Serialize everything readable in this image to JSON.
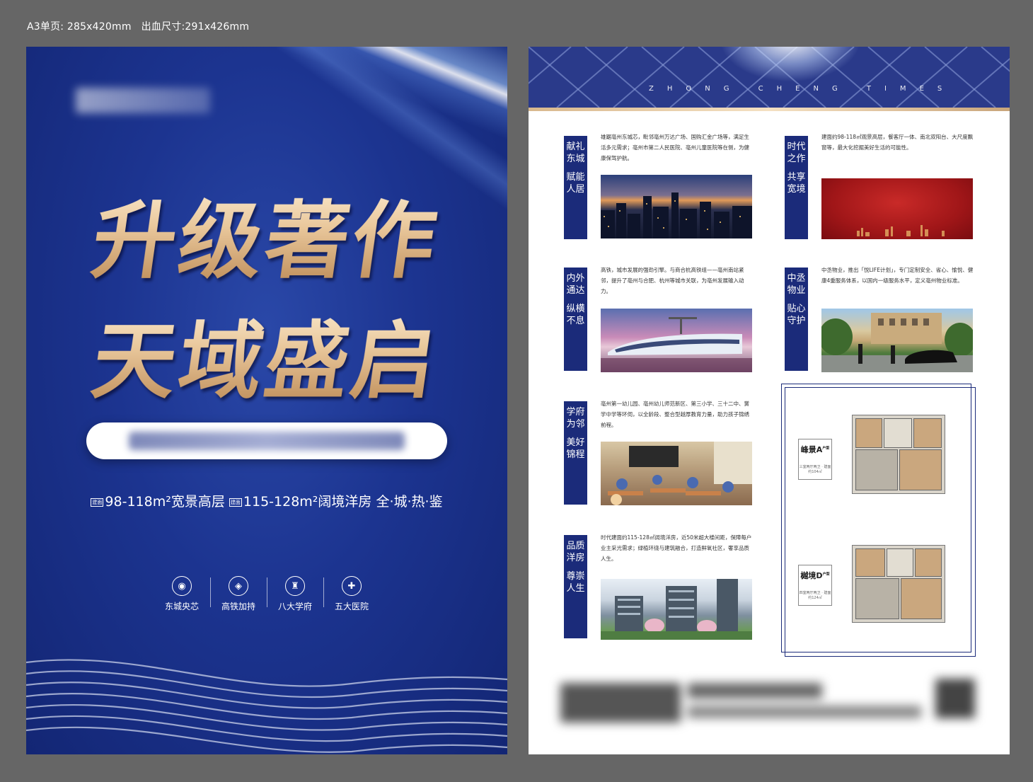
{
  "spec": {
    "page_size": "A3单页: 285x420mm",
    "bleed_size": "出血尺寸:291x426mm"
  },
  "front": {
    "headline_1": "升级著作",
    "headline_2": "天域盛启",
    "tagline": {
      "part1": "98-118m²宽景高层",
      "part2": "115-128m²阔境洋房",
      "part3": "全·城·热·鉴"
    },
    "features": [
      {
        "icon": "location-icon",
        "label": "东城央芯"
      },
      {
        "icon": "rail-icon",
        "label": "高铁加持"
      },
      {
        "icon": "school-icon",
        "label": "八大学府"
      },
      {
        "icon": "hospital-icon",
        "label": "五大医院"
      }
    ]
  },
  "back": {
    "banner_subtitle": "ZHONG CHENG TIMES",
    "sections": [
      {
        "title_a": "献礼东城",
        "title_b": "赋能人居",
        "desc": "雄踞亳州东城芯，毗邻亳州万达广场、国购汇金广场等，满足生活多元需求；亳州市第二人民医院、亳州儿童医院等在侧，为健康保驾护航。"
      },
      {
        "title_a": "时代之作",
        "title_b": "共享宽境",
        "desc": "建面约98-118㎡观景高层，餐客厅一体、南北双阳台、大尺度飘窗等，最大化挖掘美好生活的可能性。"
      },
      {
        "title_a": "内外通达",
        "title_b": "纵横不息",
        "desc": "高铁，城市发展的强劲引擎。与商合杭高铁组——亳州南站紧邻，提升了亳州与合肥、杭州等城市关联，为亳州发展输入动力。"
      },
      {
        "title_a": "中丞物业",
        "title_b": "贴心守护",
        "desc": "中丞物业，推出「悦LIFE计划」，专门定制安全、省心、愉悦、健康4重服务体系，以国内一级服务水平，定义亳州物业标准。"
      },
      {
        "title_a": "学府为邻",
        "title_b": "美好锦程",
        "desc": "亳州第一幼儿园、亳州幼儿师范新区、第三小学、三十二中、黉学中学等环伺，以全龄段、整合型越厚教育力量，助力孩子锦绣前程。"
      },
      {
        "title_a": "品质洋房",
        "title_b": "尊崇人生",
        "desc": "时代建面约115-128㎡阔境洋房，近50米超大楼间距，保障每户业主采光需求；绿植环绕与建筑融合，打造鲜氧社区，奢享品质人生。"
      }
    ],
    "plans": [
      {
        "name": "峰景A",
        "sup": "户型",
        "note": "三室两厅两卫 · 建面约104㎡"
      },
      {
        "name": "樾境D",
        "sup": "户型",
        "note": "四室两厅两卫 · 建面约124㎡"
      }
    ]
  },
  "colors": {
    "navy": "#1b2b7a",
    "gold": "#e9c79b",
    "background": "#666666"
  }
}
